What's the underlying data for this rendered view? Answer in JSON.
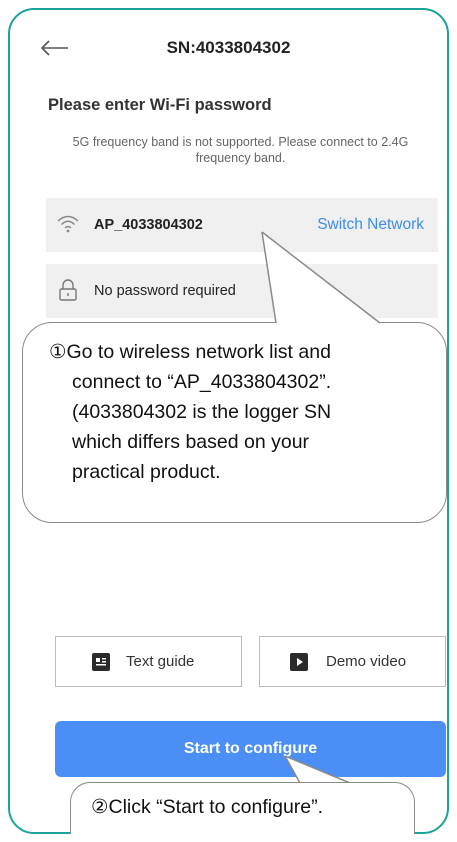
{
  "header": {
    "title": "SN:4033804302",
    "back_icon": "arrow-left-icon"
  },
  "section_title": "Please enter Wi-Fi password",
  "note": "5G frequency band is not supported. Please connect to 2.4G frequency band.",
  "network": {
    "ssid": "AP_4033804302",
    "switch_label": "Switch Network",
    "icon": "wifi-icon"
  },
  "password": {
    "text": "No password required",
    "icon": "lock-icon"
  },
  "callout1": {
    "lines": [
      "①Go to wireless network list and",
      "connect to “AP_4033804302”.",
      "(4033804302 is the logger SN",
      "which differs based on your",
      "practical product."
    ]
  },
  "buttons": {
    "text_guide": "Text guide",
    "demo_video": "Demo video",
    "start": "Start to configure"
  },
  "callout2": {
    "text": "②Click “Start to configure”."
  },
  "colors": {
    "accent": "#4a8ef6",
    "link": "#3a8ee6",
    "frame": "#1aa39a"
  }
}
